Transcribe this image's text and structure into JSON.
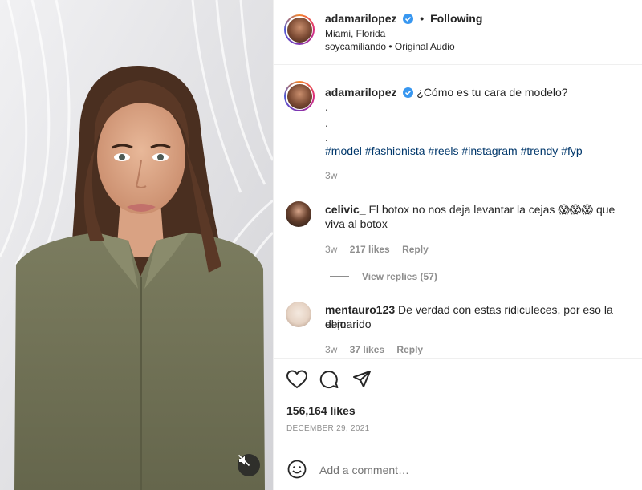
{
  "header": {
    "username": "adamarilopez",
    "following_label": "Following",
    "location": "Miami, Florida",
    "audio": "soycamiliando • Original Audio"
  },
  "caption": {
    "username": "adamarilopez",
    "text": "¿Cómo es tu cara de modelo?",
    "dots": [
      ".",
      ".",
      "."
    ],
    "hashtags": "#model #fashionista #reels #instagram #trendy #fyp",
    "time": "3w"
  },
  "comments": [
    {
      "username": "celivic_",
      "text_line1": "El botox no nos deja levantar la cejas 😱😱😱 que",
      "text_line2": "viva al botox",
      "time": "3w",
      "likes": "217 likes",
      "reply_label": "Reply",
      "view_replies": "View replies (57)"
    },
    {
      "username": "mentauro123",
      "text_line1": "De verdad con estas ridiculeces, por eso la dejo",
      "text_line2": "el marido",
      "time": "3w",
      "likes": "37 likes",
      "reply_label": "Reply"
    }
  ],
  "actions": {
    "icons": [
      "heart-icon",
      "comment-icon",
      "share-icon"
    ],
    "likes": "156,164 likes",
    "date": "DECEMBER 29, 2021"
  },
  "add_comment": {
    "placeholder": "Add a comment…",
    "icon": "emoji-icon"
  },
  "colors": {
    "verified": "#3897f0",
    "hashtag": "#00376b",
    "muted": "#8e8e8e",
    "shirt": "#76775a"
  }
}
